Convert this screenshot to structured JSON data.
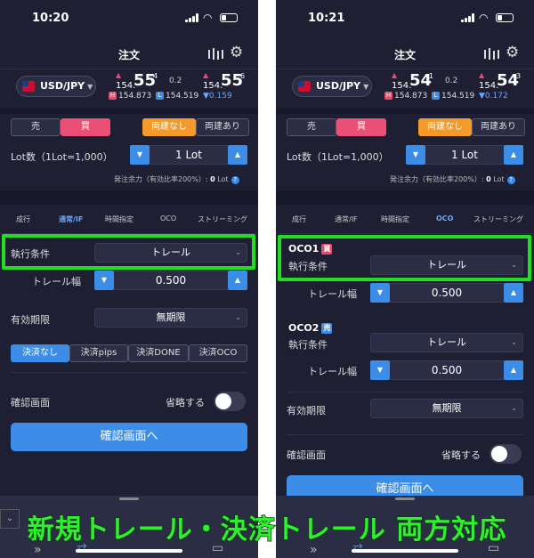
{
  "caption": "新規トレール・決済トレール 両方対応",
  "colors": {
    "highlight": "#22dd22",
    "accent": "#3b8de8",
    "sell_red": "#ea4f75",
    "orange": "#f39a2b",
    "bg": "#1e1f33"
  },
  "left": {
    "time": "10:20",
    "title": "注文",
    "pair": "USD/JPY",
    "bid": {
      "pre": "154.",
      "big": "55",
      "sup": "4"
    },
    "spread": "0.2",
    "ask": {
      "pre": "154.",
      "big": "55",
      "sup": "6"
    },
    "high": "154.873",
    "low": "154.519",
    "change": "▼0.159",
    "sell": "売",
    "buy": "買",
    "no_hedge": "両建なし",
    "hedge": "両建あり",
    "lot_label": "Lot数（1Lot=1,000）",
    "lot_value": "1 Lot",
    "margin_label": "発注余力（有効比率200%）:",
    "margin_value": "0",
    "margin_unit": "Lot",
    "tabs": [
      "成行",
      "通常/IF",
      "時間指定",
      "OCO",
      "ストリーミング"
    ],
    "exec_label": "執行条件",
    "exec_value": "トレール",
    "trail_label": "トレール幅",
    "trail_value": "0.500",
    "valid_label": "有効期限",
    "valid_value": "無期限",
    "settle": [
      "決済なし",
      "決済pips",
      "決済DONE",
      "決済OCO"
    ],
    "confirm_label": "確認画面",
    "skip_label": "省略する",
    "confirm_btn": "確認画面へ"
  },
  "right": {
    "time": "10:21",
    "title": "注文",
    "pair": "USD/JPY",
    "bid": {
      "pre": "154.",
      "big": "54",
      "sup": "1"
    },
    "spread": "0.2",
    "ask": {
      "pre": "154.",
      "big": "54",
      "sup": "3"
    },
    "high": "154.873",
    "low": "154.519",
    "change": "▼0.172",
    "sell": "売",
    "buy": "買",
    "no_hedge": "両建なし",
    "hedge": "両建あり",
    "lot_label": "Lot数（1Lot=1,000）",
    "lot_value": "1 Lot",
    "margin_label": "発注余力（有効比率200%）:",
    "margin_value": "0",
    "margin_unit": "Lot",
    "tabs": [
      "成行",
      "通常/IF",
      "時間指定",
      "OCO",
      "ストリーミング"
    ],
    "oco1": "OCO1",
    "oco1_badge": "買",
    "oco2": "OCO2",
    "oco2_badge": "売",
    "exec_label": "執行条件",
    "exec_value": "トレール",
    "trail_label": "トレール幅",
    "trail_value": "0.500",
    "valid_label": "有効期限",
    "valid_value": "無期限",
    "confirm_label": "確認画面",
    "skip_label": "省略する",
    "confirm_btn": "確認画面へ"
  }
}
